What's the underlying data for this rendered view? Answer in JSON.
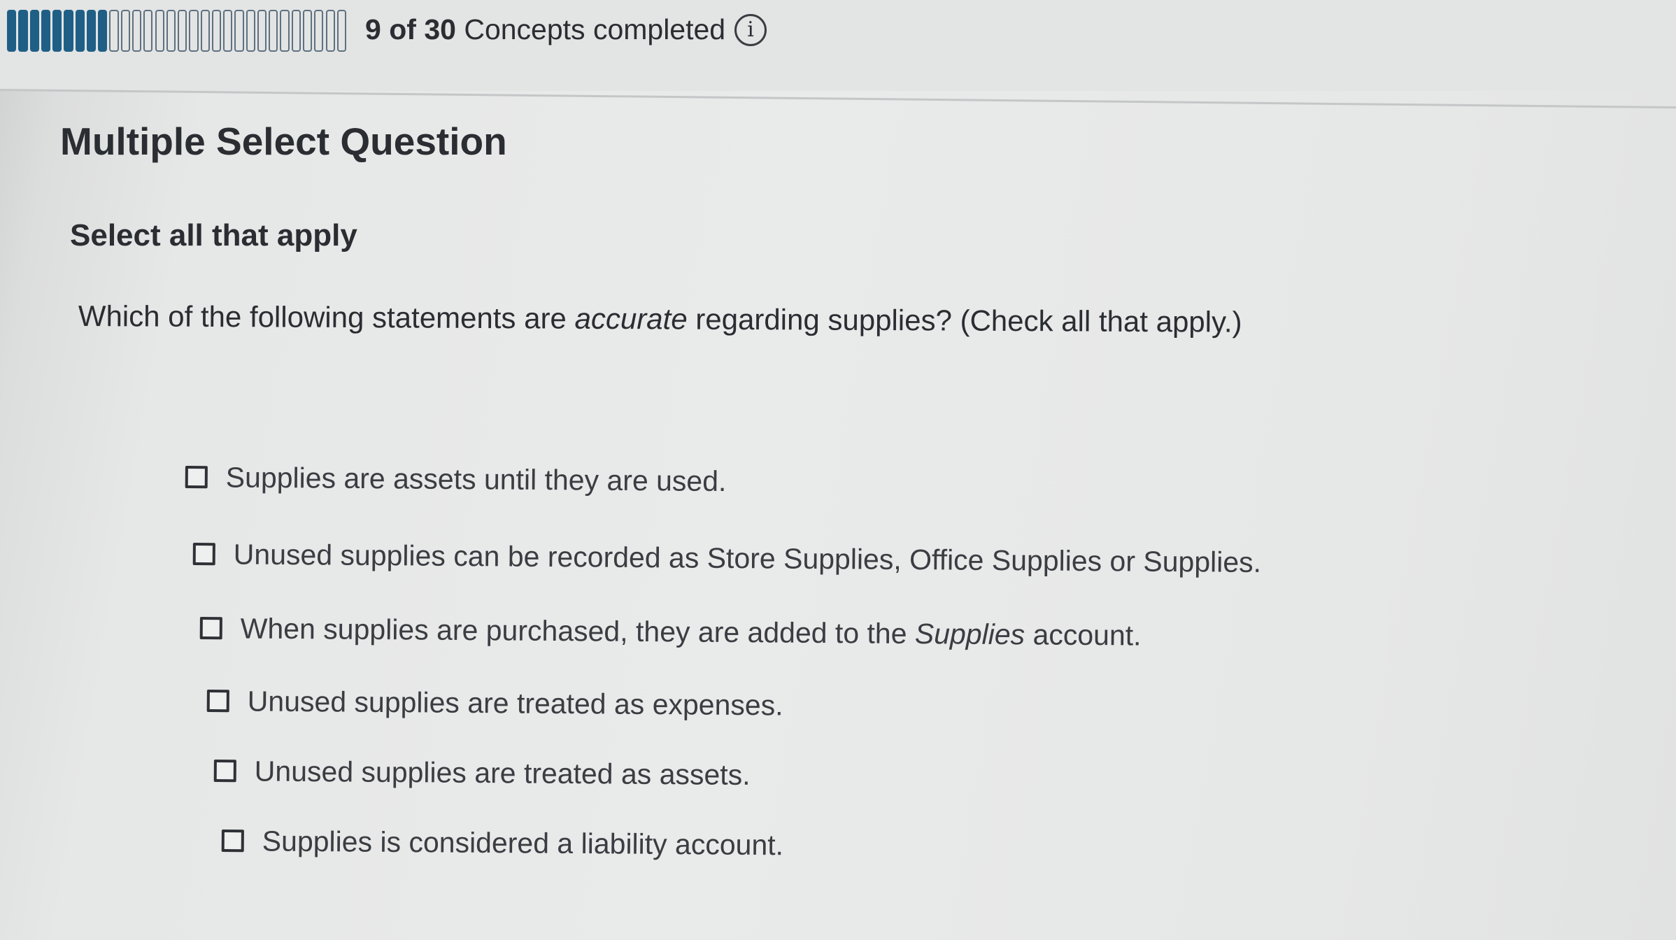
{
  "progress": {
    "completed": 9,
    "total": 30,
    "completed_text": "9",
    "of_word": "of",
    "total_text": "30",
    "suffix": "Concepts completed"
  },
  "info_icon": {
    "icon": "info-circle-icon",
    "glyph": "i"
  },
  "question": {
    "type_heading": "Multiple Select Question",
    "instruction": "Select all that apply",
    "prompt_before": "Which of the following statements are ",
    "prompt_emphasis": "accurate",
    "prompt_after": " regarding supplies? (Check all that apply.)"
  },
  "options": [
    {
      "text": "Supplies are assets until they are used.",
      "checked": false
    },
    {
      "text": "Unused supplies can be recorded as Store Supplies, Office Supplies or Supplies.",
      "checked": false
    },
    {
      "text_before": "When supplies are purchased, they are added to the ",
      "text_emphasis": "Supplies",
      "text_after": " account.",
      "checked": false
    },
    {
      "text": "Unused supplies are treated as expenses.",
      "checked": false
    },
    {
      "text": "Unused supplies are treated as assets.",
      "checked": false
    },
    {
      "text": "Supplies is considered a liability account.",
      "checked": false
    }
  ],
  "colors": {
    "progress_fill": "#1f5f86",
    "background": "#e9eaea",
    "text": "#2a2d31"
  }
}
